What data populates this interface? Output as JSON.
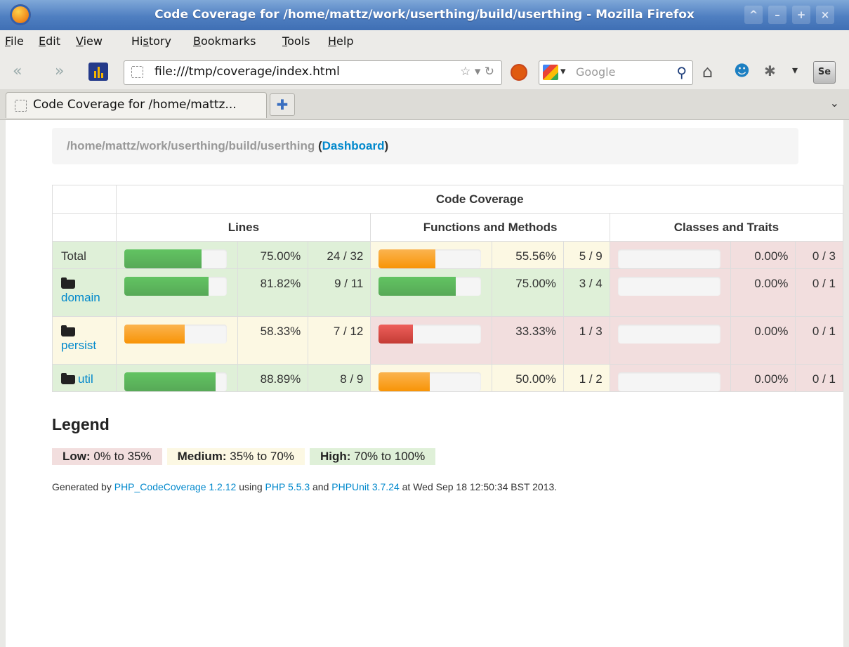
{
  "window": {
    "title": "Code Coverage for /home/mattz/work/userthing/build/userthing - Mozilla Firefox"
  },
  "menu": {
    "items": [
      {
        "pre": "",
        "u": "F",
        "post": "ile"
      },
      {
        "pre": "",
        "u": "E",
        "post": "dit"
      },
      {
        "pre": "",
        "u": "V",
        "post": "iew"
      },
      {
        "pre": "Hi",
        "u": "s",
        "post": "tory"
      },
      {
        "pre": "",
        "u": "B",
        "post": "ookmarks"
      },
      {
        "pre": "",
        "u": "T",
        "post": "ools"
      },
      {
        "pre": "",
        "u": "H",
        "post": "elp"
      }
    ]
  },
  "navbar": {
    "url": "file:///tmp/coverage/index.html",
    "search_placeholder": "Google"
  },
  "tabs": [
    {
      "label": "Code Coverage for /home/mattz..."
    }
  ],
  "page": {
    "breadcrumb_path": "/home/mattz/work/userthing/build/userthing",
    "breadcrumb_link": "Dashboard",
    "table": {
      "header_main": "Code Coverage",
      "col_lines": "Lines",
      "col_functions": "Functions and Methods",
      "col_classes": "Classes and Traits",
      "rows": [
        {
          "name": "Total",
          "folder": false,
          "row_bg": "high",
          "lines": {
            "fraction": 0.75,
            "level": "success",
            "bg": "high",
            "pct": "75.00%",
            "count": "24 / 32"
          },
          "functions": {
            "fraction": 0.5556,
            "level": "warning",
            "bg": "med",
            "pct": "55.56%",
            "count": "5 / 9"
          },
          "classes": {
            "fraction": 0.0,
            "level": "danger",
            "bg": "low",
            "pct": "0.00%",
            "count": "0 / 3"
          }
        },
        {
          "name": "domain",
          "folder": true,
          "row_bg": "high",
          "lines": {
            "fraction": 0.8182,
            "level": "success",
            "bg": "high",
            "pct": "81.82%",
            "count": "9 / 11"
          },
          "functions": {
            "fraction": 0.75,
            "level": "success",
            "bg": "high",
            "pct": "75.00%",
            "count": "3 / 4"
          },
          "classes": {
            "fraction": 0.0,
            "level": "danger",
            "bg": "low",
            "pct": "0.00%",
            "count": "0 / 1"
          }
        },
        {
          "name": "persist",
          "folder": true,
          "row_bg": "med",
          "lines": {
            "fraction": 0.5833,
            "level": "warning",
            "bg": "med",
            "pct": "58.33%",
            "count": "7 / 12"
          },
          "functions": {
            "fraction": 0.3333,
            "level": "danger",
            "bg": "low",
            "pct": "33.33%",
            "count": "1 / 3"
          },
          "classes": {
            "fraction": 0.0,
            "level": "danger",
            "bg": "low",
            "pct": "0.00%",
            "count": "0 / 1"
          }
        },
        {
          "name": "util",
          "folder": true,
          "row_bg": "high",
          "lines": {
            "fraction": 0.8889,
            "level": "success",
            "bg": "high",
            "pct": "88.89%",
            "count": "8 / 9"
          },
          "functions": {
            "fraction": 0.5,
            "level": "warning",
            "bg": "med",
            "pct": "50.00%",
            "count": "1 / 2"
          },
          "classes": {
            "fraction": 0.0,
            "level": "danger",
            "bg": "low",
            "pct": "0.00%",
            "count": "0 / 1"
          }
        }
      ]
    },
    "legend": {
      "title": "Legend",
      "low_label": "Low:",
      "low_range": "0% to 35%",
      "medium_label": "Medium:",
      "medium_range": "35% to 70%",
      "high_label": "High:",
      "high_range": "70% to 100%"
    },
    "footer": {
      "generated_by": "Generated by",
      "tool_link": "PHP_CodeCoverage 1.2.12",
      "using": "using",
      "php_link": "PHP 5.5.3",
      "and": "and",
      "phpunit_link": "PHPUnit 3.7.24",
      "timestamp": "at Wed Sep 18 12:50:34 BST 2013."
    }
  },
  "colors": {
    "link": "#0088cc",
    "low_bg": "#f2dede",
    "medium_bg": "#fcf8e3",
    "high_bg": "#dff0d8",
    "bar_success": "#5cb85c",
    "bar_warning": "#f89406",
    "bar_danger": "#d9534f"
  }
}
